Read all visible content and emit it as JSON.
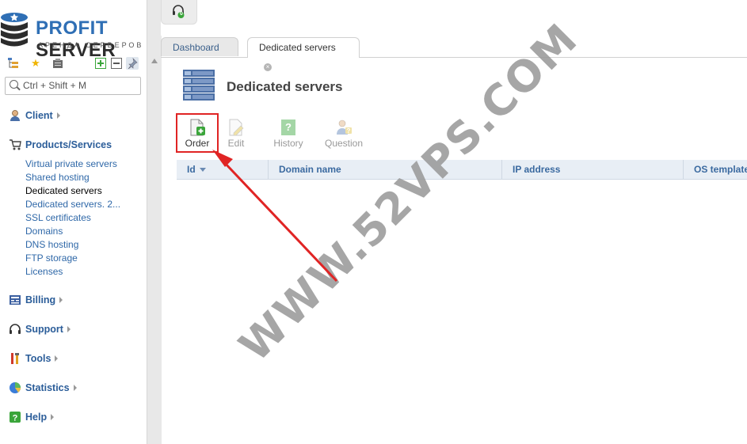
{
  "logo": {
    "name_part1": "PROFIT",
    "name_part2": " SERVER",
    "tagline": "АРЕНДА СЕРВЕРОВ"
  },
  "sidebar": {
    "search": {
      "placeholder": "Ctrl + Shift + M"
    },
    "groups": [
      {
        "label": "Client",
        "icon": "user-icon"
      },
      {
        "label": "Products/Services",
        "icon": "cart-icon",
        "items": [
          {
            "label": "Virtual private servers"
          },
          {
            "label": "Shared hosting"
          },
          {
            "label": "Dedicated servers",
            "active": true
          },
          {
            "label": "Dedicated servers. 2..."
          },
          {
            "label": "SSL certificates"
          },
          {
            "label": "Domains"
          },
          {
            "label": "DNS hosting"
          },
          {
            "label": "FTP storage"
          },
          {
            "label": "Licenses"
          }
        ]
      },
      {
        "label": "Billing",
        "icon": "billing-icon"
      },
      {
        "label": "Support",
        "icon": "headset-icon"
      },
      {
        "label": "Tools",
        "icon": "tools-icon"
      },
      {
        "label": "Statistics",
        "icon": "pie-chart-icon"
      },
      {
        "label": "Help",
        "icon": "help-icon"
      }
    ]
  },
  "topbar": {
    "notification_count": "0"
  },
  "tabs": [
    {
      "label": "Dashboard"
    },
    {
      "label": "Dedicated servers",
      "active": true,
      "closable": true
    }
  ],
  "main": {
    "title": "Dedicated servers",
    "toolbar": [
      {
        "label": "Order",
        "enabled": true,
        "icon": "new-order-icon"
      },
      {
        "label": "Edit",
        "enabled": false,
        "icon": "edit-icon"
      },
      {
        "label": "History",
        "enabled": false,
        "icon": "history-icon"
      },
      {
        "label": "Question",
        "enabled": false,
        "icon": "question-icon"
      }
    ],
    "table": {
      "columns": [
        {
          "label": "Id",
          "sorted": "desc"
        },
        {
          "label": "Domain name"
        },
        {
          "label": "IP address"
        },
        {
          "label": "OS template"
        }
      ],
      "rows": []
    }
  },
  "watermark": "WWW.52VPS.COM",
  "colors": {
    "accent": "#2f6fb5",
    "link": "#2f68a8",
    "highlight": "#e02424",
    "active_icon": "#3aa53a"
  }
}
